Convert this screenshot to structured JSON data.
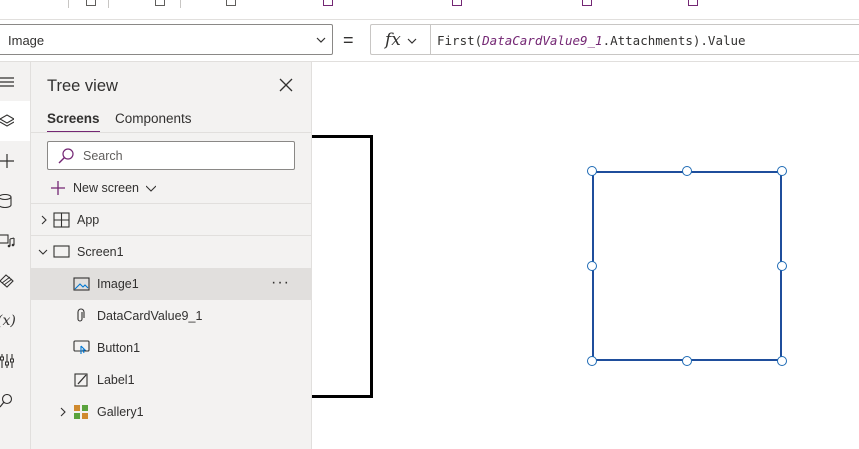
{
  "formula_bar": {
    "property": "Image",
    "equals": "=",
    "fx_label": "fx",
    "formula": {
      "fn_open": "First(",
      "control": "DataCardValue9_1",
      "rest": ".Attachments).Value"
    }
  },
  "rail": {
    "items": [
      "menu-icon",
      "layers-icon",
      "plus-icon",
      "database-icon",
      "media-icon",
      "theme-icon",
      "variables-icon",
      "tools-icon",
      "search-icon"
    ],
    "active_index": 1,
    "variables_glyph": "(x)"
  },
  "tree_view": {
    "title": "Tree view",
    "tabs": [
      {
        "label": "Screens",
        "active": true
      },
      {
        "label": "Components",
        "active": false
      }
    ],
    "search": {
      "placeholder": "Search",
      "value": ""
    },
    "new_screen_label": "New screen",
    "nodes": [
      {
        "label": "App",
        "icon": "app-icon",
        "expander": "collapsed"
      },
      {
        "label": "Screen1",
        "icon": "screen-icon",
        "expander": "expanded"
      },
      {
        "label": "Image1",
        "icon": "image-icon",
        "selected": true,
        "more": "···"
      },
      {
        "label": "DataCardValue9_1",
        "icon": "attachment-icon"
      },
      {
        "label": "Button1",
        "icon": "button-icon"
      },
      {
        "label": "Label1",
        "icon": "label-icon"
      },
      {
        "label": "Gallery1",
        "icon": "gallery-icon",
        "expander": "collapsed"
      }
    ]
  },
  "colors": {
    "accent": "#742774",
    "selection": "#1f4e9c",
    "panel_bg": "#f3f2f1",
    "selected_row": "#e1dfdd"
  }
}
